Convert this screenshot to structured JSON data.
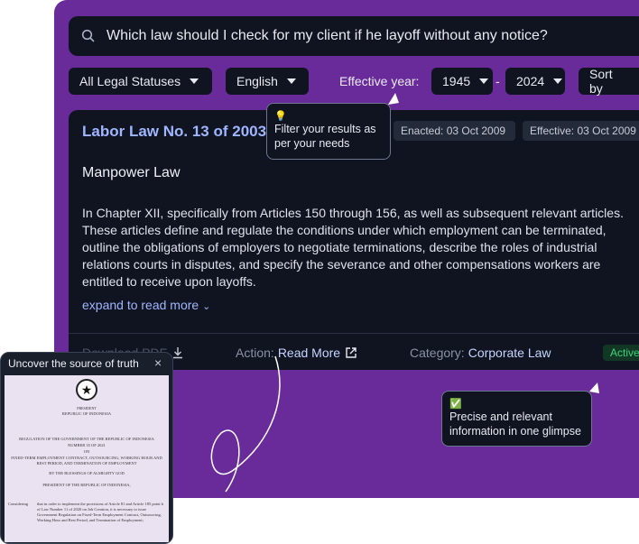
{
  "search": {
    "query": "Which law should I check for my client if he layoff without any notice?"
  },
  "filters": {
    "legal_status": "All Legal Statuses",
    "language": "English",
    "effective_label": "Effective year:",
    "year_from": "1945",
    "year_sep": "-",
    "year_to": "2024",
    "sort_label": "Sort by"
  },
  "result": {
    "title": "Labor Law No. 13 of 2003",
    "enacted": "Enacted: 03 Oct 2009",
    "effective": "Effective: 03 Oct 2009",
    "subtitle": "Manpower Law",
    "description": "In Chapter XII, specifically from Articles 150 through 156, as well as subsequent relevant articles. These articles define and regulate the conditions under which employment can be terminated, outline the obligations of employers to negotiate terminations, describe the roles of industrial relations courts in disputes, and specify the severance and other compensations workers are entitled to receive upon layoffs.",
    "expand": "expand to read more",
    "download": "Download PDF",
    "action_label": "Action:",
    "action_value": "Read More",
    "category_label": "Category:",
    "category_value": "Corporate Law",
    "status": "Active"
  },
  "tooltips": {
    "filter": {
      "emoji": "💡",
      "text": "Filter your results as per your needs"
    },
    "precise": {
      "emoji": "✅",
      "text": "Precise and relevant information in one glimpse"
    }
  },
  "source_panel": {
    "title": "Uncover the source of truth",
    "close": "×",
    "doc": {
      "header1": "PRESIDENT",
      "header2": "REPUBLIC OF INDONESIA",
      "line1": "REGULATION OF THE GOVERNMENT OF THE REPUBLIC OF INDONESIA",
      "line2": "NUMBER 35 OF 2021",
      "line3": "ON",
      "line4": "FIXED-TERM EMPLOYMENT CONTRACT, OUTSOURCING, WORKING HOUR AND REST PERIOD, AND TERMINATION OF EMPLOYMENT",
      "line5": "BY THE BLESSINGS OF ALMIGHTY GOD",
      "line6": "PRESIDENT OF THE REPUBLIC OF INDONESIA,",
      "considering": "Considering",
      "body": "that in order to implement the provisions of Article 81 and Article 185 point b of Law Number 11 of 2020 on Job Creation, it is necessary to issue Government Regulation on Fixed-Term Employment Contract, Outsourcing, Working Hour and Rest Period, and Termination of Employment;"
    }
  },
  "colors": {
    "background": "#6a2b9a",
    "panel": "#0f1420",
    "accent": "#9fb6ff",
    "active": "#3fd27a"
  }
}
